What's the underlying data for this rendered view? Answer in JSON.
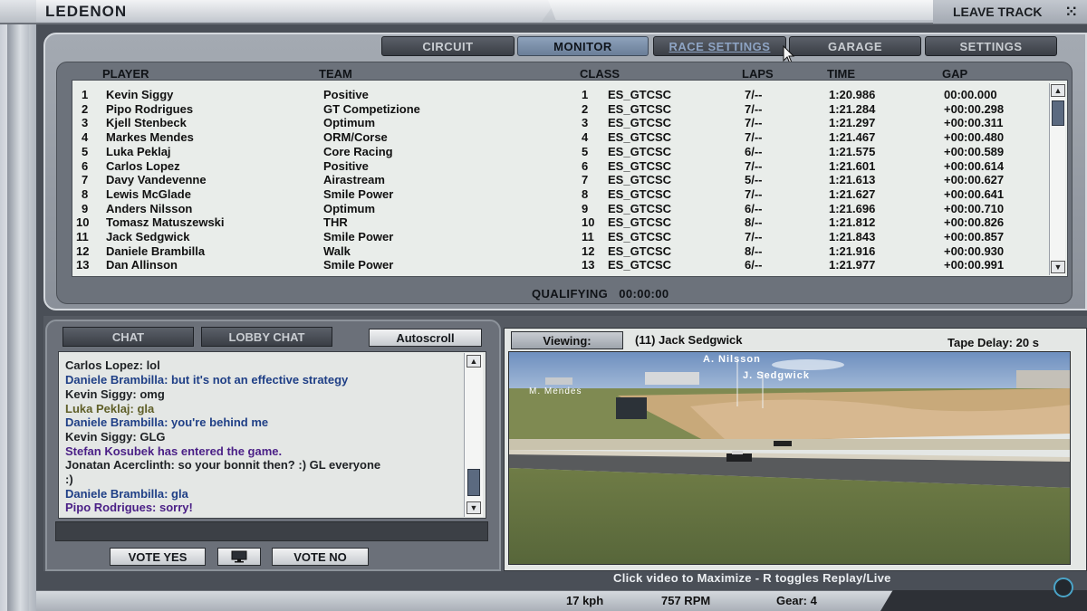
{
  "top_bar": {
    "track_name": "LEDENON",
    "leave_track_label": "LEAVE TRACK"
  },
  "tabs": [
    {
      "label": "CIRCUIT",
      "state": "normal"
    },
    {
      "label": "MONITOR",
      "state": "active"
    },
    {
      "label": "RACE SETTINGS",
      "state": "hover"
    },
    {
      "label": "GARAGE",
      "state": "normal"
    },
    {
      "label": "SETTINGS",
      "state": "normal"
    }
  ],
  "results": {
    "headers": {
      "player": "PLAYER",
      "team": "TEAM",
      "class": "CLASS",
      "laps": "LAPS",
      "time": "TIME",
      "gap": "GAP"
    },
    "rows": [
      {
        "pos": "1",
        "player": "Kevin Siggy",
        "team": "Positive",
        "class_pos": "1",
        "class": "ES_GTCSC",
        "laps": "7/--",
        "time": "1:20.986",
        "gap": "00:00.000"
      },
      {
        "pos": "2",
        "player": "Pipo Rodrigues",
        "team": "GT Competizione",
        "class_pos": "2",
        "class": "ES_GTCSC",
        "laps": "7/--",
        "time": "1:21.284",
        "gap": "+00:00.298"
      },
      {
        "pos": "3",
        "player": "Kjell Stenbeck",
        "team": "Optimum",
        "class_pos": "3",
        "class": "ES_GTCSC",
        "laps": "7/--",
        "time": "1:21.297",
        "gap": "+00:00.311"
      },
      {
        "pos": "4",
        "player": "Markes Mendes",
        "team": "ORM/Corse",
        "class_pos": "4",
        "class": "ES_GTCSC",
        "laps": "7/--",
        "time": "1:21.467",
        "gap": "+00:00.480"
      },
      {
        "pos": "5",
        "player": "Luka Peklaj",
        "team": "Core Racing",
        "class_pos": "5",
        "class": "ES_GTCSC",
        "laps": "6/--",
        "time": "1:21.575",
        "gap": "+00:00.589"
      },
      {
        "pos": "6",
        "player": "Carlos Lopez",
        "team": "Positive",
        "class_pos": "6",
        "class": "ES_GTCSC",
        "laps": "7/--",
        "time": "1:21.601",
        "gap": "+00:00.614"
      },
      {
        "pos": "7",
        "player": "Davy Vandevenne",
        "team": "Airastream",
        "class_pos": "7",
        "class": "ES_GTCSC",
        "laps": "5/--",
        "time": "1:21.613",
        "gap": "+00:00.627"
      },
      {
        "pos": "8",
        "player": "Lewis McGlade",
        "team": "Smile Power",
        "class_pos": "8",
        "class": "ES_GTCSC",
        "laps": "7/--",
        "time": "1:21.627",
        "gap": "+00:00.641"
      },
      {
        "pos": "9",
        "player": "Anders Nilsson",
        "team": "Optimum",
        "class_pos": "9",
        "class": "ES_GTCSC",
        "laps": "6/--",
        "time": "1:21.696",
        "gap": "+00:00.710"
      },
      {
        "pos": "10",
        "player": "Tomasz Matuszewski",
        "team": "THR",
        "class_pos": "10",
        "class": "ES_GTCSC",
        "laps": "8/--",
        "time": "1:21.812",
        "gap": "+00:00.826"
      },
      {
        "pos": "11",
        "player": "Jack Sedgwick",
        "team": "Smile Power",
        "class_pos": "11",
        "class": "ES_GTCSC",
        "laps": "7/--",
        "time": "1:21.843",
        "gap": "+00:00.857"
      },
      {
        "pos": "12",
        "player": "Daniele Brambilla",
        "team": "Walk",
        "class_pos": "12",
        "class": "ES_GTCSC",
        "laps": "8/--",
        "time": "1:21.916",
        "gap": "+00:00.930"
      },
      {
        "pos": "13",
        "player": "Dan Allinson",
        "team": "Smile Power",
        "class_pos": "13",
        "class": "ES_GTCSC",
        "laps": "6/--",
        "time": "1:21.977",
        "gap": "+00:00.991"
      }
    ]
  },
  "session": {
    "label": "QUALIFYING",
    "timer": "00:00:00"
  },
  "chat": {
    "tab_chat": "CHAT",
    "tab_lobby": "LOBBY CHAT",
    "autoscroll_label": "Autoscroll",
    "lines": [
      {
        "text": "Carlos Lopez: lol",
        "color": "#1e2124"
      },
      {
        "text": "Daniele Brambilla: but it's not an effective strategy",
        "color": "#1f3f86"
      },
      {
        "text": "Kevin Siggy: omg",
        "color": "#1e2124"
      },
      {
        "text": "Luka Peklaj: gla",
        "color": "#5f5f28"
      },
      {
        "text": "Daniele Brambilla: you're behind me",
        "color": "#1f3f86"
      },
      {
        "text": "Kevin Siggy: GLG",
        "color": "#1e2124"
      },
      {
        "text": "Stefan Kosubek has entered the game.",
        "color": "#4a1f86"
      },
      {
        "text": "Jonatan Acerclinth: so your bonnit then? :)  GL everyone",
        "color": "#1e2124"
      },
      {
        "text": ":)",
        "color": "#1e2124"
      },
      {
        "text": "Daniele Brambilla: gla",
        "color": "#1f3f86"
      },
      {
        "text": "Pipo Rodrigues: sorry!",
        "color": "#4a1f86"
      }
    ],
    "vote_yes": "VOTE YES",
    "vote_no": "VOTE NO"
  },
  "video": {
    "viewing_label": "Viewing:",
    "viewing_driver": "(11) Jack Sedgwick",
    "tape_delay": "Tape Delay: 20 s",
    "tag_nilsson": "A. Nilsson",
    "tag_sedgwick": "J. Sedgwick",
    "tag_mendes": "M. Mendes",
    "hint": "Click video to Maximize  -  R toggles Replay/Live"
  },
  "telemetry": {
    "speed": "17 kph",
    "rpm": "757 RPM",
    "gear": "Gear: 4"
  }
}
